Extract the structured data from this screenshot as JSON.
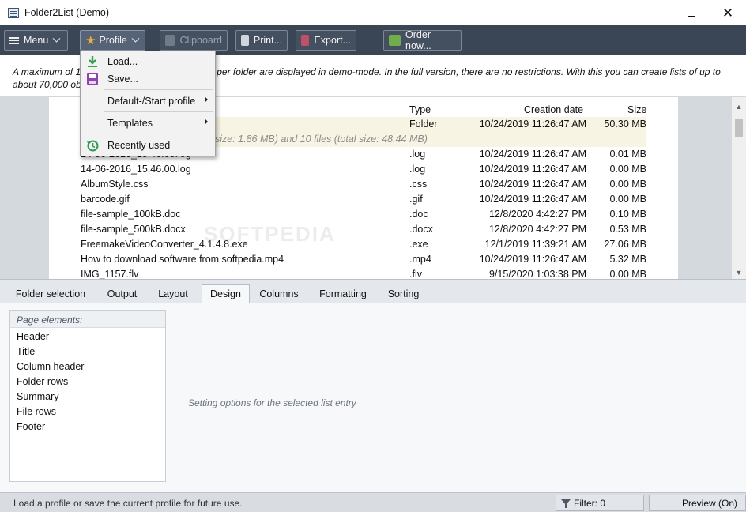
{
  "window": {
    "title": "Folder2List (Demo)",
    "minimize": "–",
    "maximize": "□",
    "close": "✕"
  },
  "toolbar": {
    "menu_label": "Menu",
    "profile_label": "Profile",
    "clipboard_label": "Clipboard",
    "print_label": "Print...",
    "export_label": "Export...",
    "order_label": "Order now..."
  },
  "banner": {
    "text": "A maximum of 1… files per folder are displayed in demo-mode. In the full version, there are no restrictions. With this you can create lists of up to about 70,000 obj…",
    "part_left": "A maximum of 1",
    "part_right": "es per folder are displayed in demo-mode. In the full version, there are no restrictions. With this you can create lists of up to",
    "part_line2": "about 70,000 obj"
  },
  "profile_menu": {
    "items": [
      {
        "label": "Load...",
        "icon": "download-arrow-icon"
      },
      {
        "label": "Save...",
        "icon": "floppy-disk-icon"
      },
      {
        "label": "Default-/Start profile",
        "icon": ""
      },
      {
        "label": "Templates",
        "icon": ""
      },
      {
        "label": "Recently used",
        "icon": "history-clock-icon"
      }
    ]
  },
  "file_list": {
    "headers": {
      "type": "Type",
      "date": "Creation date",
      "size": "Size"
    },
    "folder_row": {
      "name": "",
      "type": "Folder",
      "date": "10/24/2019 11:26:47 AM",
      "size": "50.30 MB"
    },
    "summary_text": "size: 1.86 MB) and 10 files (total size: 48.44 MB)",
    "rows": [
      {
        "name": "14-06-2016_15.46.00.log",
        "type": ".log",
        "date": "10/24/2019 11:26:47 AM",
        "size": "0.01 MB"
      },
      {
        "name": "14-06-2016_15.46.00.log",
        "type": ".log",
        "date": "10/24/2019 11:26:47 AM",
        "size": "0.00 MB"
      },
      {
        "name": "AlbumStyle.css",
        "type": ".css",
        "date": "10/24/2019 11:26:47 AM",
        "size": "0.00 MB"
      },
      {
        "name": "barcode.gif",
        "type": ".gif",
        "date": "10/24/2019 11:26:47 AM",
        "size": "0.00 MB"
      },
      {
        "name": "file-sample_100kB.doc",
        "type": ".doc",
        "date": "12/8/2020 4:42:27 PM",
        "size": "0.10 MB"
      },
      {
        "name": "file-sample_500kB.docx",
        "type": ".docx",
        "date": "12/8/2020 4:42:27 PM",
        "size": "0.53 MB"
      },
      {
        "name": "FreemakeVideoConverter_4.1.4.8.exe",
        "type": ".exe",
        "date": "12/1/2019 11:39:21 AM",
        "size": "27.06 MB"
      },
      {
        "name": "How to download software from softpedia.mp4",
        "type": ".mp4",
        "date": "10/24/2019 11:26:47 AM",
        "size": "5.32 MB"
      },
      {
        "name": "IMG_1157.flv",
        "type": ".flv",
        "date": "9/15/2020 1:03:38 PM",
        "size": "0.00 MB"
      }
    ]
  },
  "tabs": [
    "Folder selection",
    "Output",
    "Layout",
    "Design",
    "Columns",
    "Formatting",
    "Sorting"
  ],
  "active_tab": "Design",
  "page_elements": {
    "header": "Page elements:",
    "items": [
      "Header",
      "Title",
      "Column header",
      "Folder rows",
      "Summary",
      "File rows",
      "Footer"
    ]
  },
  "hint_text": "Setting options for the selected list entry",
  "statusbar": {
    "message": "Load a profile or save the current profile for future use.",
    "filter": "Filter: 0",
    "preview": "Preview (On)"
  },
  "colors": {
    "toolbar_bg": "#3a4655",
    "folder_row_bg": "#f8f4e3",
    "star": "#e9b43a",
    "load_icon": "#3aa04a",
    "save_icon": "#8e44ad",
    "history_icon": "#2e9a55"
  }
}
